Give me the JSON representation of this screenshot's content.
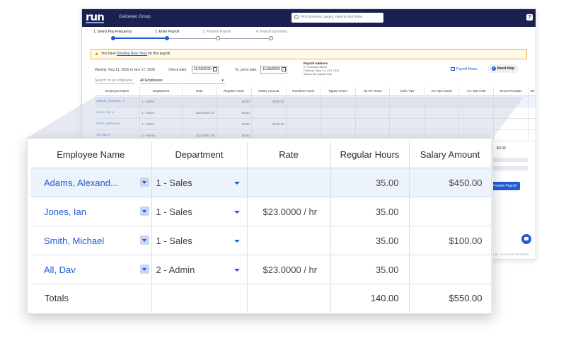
{
  "app": {
    "logo": "run",
    "company": "Gallowalo Group",
    "search_placeholder": "Find answers, pages, reports and more",
    "help_label": "?"
  },
  "steps": [
    {
      "label": "1. Select Pay Frequency",
      "done": true
    },
    {
      "label": "2. Enter Payroll",
      "done": true
    },
    {
      "label": "3. Preview Payroll",
      "done": false
    },
    {
      "label": "4. Payroll Summary",
      "done": false
    }
  ],
  "alert": {
    "prefix": "You have",
    "link": "Pending New Hires",
    "suffix": "for this payroll"
  },
  "period": {
    "weekly": "Weekly: Nov 11, 2020 to Nov 17, 2020",
    "check_label": "Check date:",
    "check_date": "11/18/2020",
    "to_label": "To, pmnt date:",
    "to_date": "11/18/2020",
    "address_title": "Payroll Address",
    "address_lines": [
      "71 Hancock Street",
      "Portland Town Co 12 4 7521",
      "Add to the payroll note"
    ],
    "notes_label": "Payroll Notes",
    "need_help": "Need Help"
  },
  "filters": {
    "search_placeholder": "Search for an employee",
    "employee_filter": "All Employees"
  },
  "mini_table": {
    "headers": [
      "Employee Name",
      "Department",
      "Rate",
      "Regular Hours",
      "Salary Amount",
      "Overtime Hours",
      "Tipped Hours",
      "Tip OT Hours",
      "Cash Tips",
      "CC Tips Owed",
      "CC Tips Paid",
      "Gross Receipts",
      "Init"
    ],
    "rows": [
      {
        "name": "Adams, Alexand...",
        "dept": "1 - Sales",
        "rate": "",
        "hours": "35.00",
        "salary": "$450.00"
      },
      {
        "name": "Jones, Ian",
        "dept": "1 - Sales",
        "rate": "$23.0000 / hr",
        "hours": "35.00",
        "salary": ""
      },
      {
        "name": "Smith, Michael",
        "dept": "1 - Sales",
        "rate": "",
        "hours": "35.00",
        "salary": "$100.00"
      },
      {
        "name": "All, Dav",
        "dept": "2 - Admin",
        "rate": "$23.0000 / hr",
        "hours": "35.00",
        "salary": ""
      }
    ]
  },
  "peek": {
    "amount": "$0.00",
    "preview_button": "Preview Payroll",
    "footer": "ADP, INC. ALL RIGHTS RESERVED"
  },
  "table": {
    "headers": {
      "employee": "Employee Name",
      "department": "Department",
      "rate": "Rate",
      "hours": "Regular Hours",
      "salary": "Salary Amount"
    },
    "rows": [
      {
        "name": "Adams, Alexand...",
        "dept": "1 - Sales",
        "rate": "",
        "hours": "35.00",
        "salary": "$450.00"
      },
      {
        "name": "Jones, Ian",
        "dept": "1 - Sales",
        "rate": "$23.0000 / hr",
        "hours": "35.00",
        "salary": ""
      },
      {
        "name": "Smith, Michael",
        "dept": "1 - Sales",
        "rate": "",
        "hours": "35.00",
        "salary": "$100.00"
      },
      {
        "name": "All, Dav",
        "dept": "2 - Admin",
        "rate": "$23.0000 / hr",
        "hours": "35.00",
        "salary": ""
      }
    ],
    "totals": {
      "label": "Totals",
      "hours": "140.00",
      "salary": "$550.00"
    }
  },
  "colors": {
    "navy": "#1b2050",
    "accent": "#1f5bd4",
    "highlight_row": "#edf3fc",
    "alert_border": "#e8b33d"
  }
}
